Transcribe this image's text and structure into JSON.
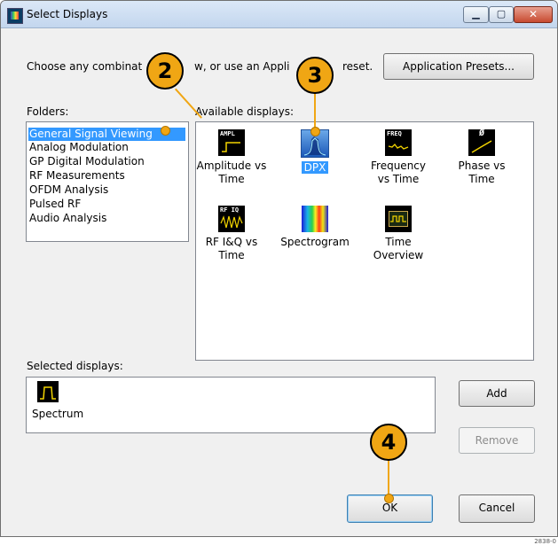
{
  "window": {
    "title": "Select Displays",
    "minimize_glyph": "▁",
    "maximize_glyph": "▢",
    "close_glyph": "✕"
  },
  "instructions": {
    "text": "Choose any combinat",
    "text_after": "w, or use an Appli",
    "text_end": "reset."
  },
  "buttons": {
    "application_presets": "Application Presets...",
    "add": "Add",
    "remove": "Remove",
    "ok": "OK",
    "cancel": "Cancel"
  },
  "folders": {
    "label": "Folders:",
    "selected_index": 0,
    "items": [
      "General Signal Viewing",
      "Analog Modulation",
      "GP Digital Modulation",
      "RF Measurements",
      "OFDM Analysis",
      "Pulsed RF",
      "Audio Analysis"
    ]
  },
  "available": {
    "label": "Available displays:",
    "items": [
      {
        "line1": "Amplitude vs",
        "line2": "Time",
        "icon": "amplitude-time-icon",
        "icon_text": "AMPL"
      },
      {
        "line1": "DPX",
        "line2": "",
        "icon": "dpx-icon",
        "icon_text": ""
      },
      {
        "line1": "Frequency",
        "line2": "vs Time",
        "icon": "frequency-time-icon",
        "icon_text": "FREQ"
      },
      {
        "line1": "Phase vs",
        "line2": "Time",
        "icon": "phase-time-icon",
        "icon_text": "Ø"
      },
      {
        "line1": "RF I&Q vs",
        "line2": "Time",
        "icon": "rf-iq-time-icon",
        "icon_text": "RF IQ"
      },
      {
        "line1": "Spectrogram",
        "line2": "",
        "icon": "spectrogram-icon",
        "icon_text": ""
      },
      {
        "line1": "Time",
        "line2": "Overview",
        "icon": "time-overview-icon",
        "icon_text": ""
      }
    ]
  },
  "selected": {
    "label": "Selected displays:",
    "items": [
      {
        "name": "Spectrum",
        "icon": "spectrum-icon"
      }
    ]
  },
  "callouts": [
    "2",
    "3",
    "4"
  ],
  "figure_ref": "2838-0",
  "colors": {
    "selection": "#3399ff",
    "callout": "#f0a614",
    "trace": "#f2d400",
    "title_bar": "#c3d6ee"
  }
}
